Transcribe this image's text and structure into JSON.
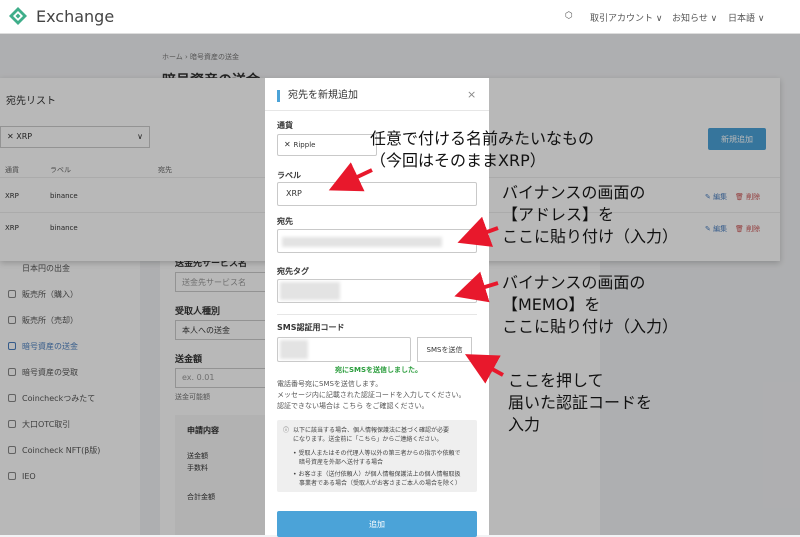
{
  "header": {
    "brand": "Exchange",
    "account_menu": "取引アカウント ∨",
    "notice_menu": "お知らせ ∨",
    "lang_menu": "日本語 ∨"
  },
  "page": {
    "breadcrumb": "ホーム  ›  暗号資産の送金",
    "title": "暗号資産の送金"
  },
  "sidebar": {
    "items": [
      {
        "label": "日本円の出金"
      },
      {
        "label": "販売所（購入）"
      },
      {
        "label": "販売所（売却）"
      },
      {
        "label": "暗号資産の送金"
      },
      {
        "label": "暗号資産の受取"
      },
      {
        "label": "Coincheckつみたて"
      },
      {
        "label": "大口OTC取引"
      },
      {
        "label": "Coincheck NFT(β版)"
      },
      {
        "label": "IEO"
      }
    ]
  },
  "main_form": {
    "service_label": "送金先サービス名",
    "service_placeholder": "送金先サービス名",
    "recipient_type_label": "受取人種別",
    "recipient_type_value": "本人への送金",
    "amount_label": "送金額",
    "amount_placeholder": "ex. 0.01",
    "available_label": "送金可能額",
    "summary_title": "申請内容",
    "summary_amount": "送金額",
    "summary_fee": "手数料",
    "summary_total": "合計金額"
  },
  "drawer": {
    "title": "宛先リスト",
    "currency_value": "XRP",
    "columns": [
      "通貨",
      "ラベル",
      "宛先"
    ],
    "rows": [
      {
        "currency": "XRP",
        "label": "binance"
      },
      {
        "currency": "XRP",
        "label": "binance"
      }
    ],
    "new_button": "新規追加",
    "edit": "✎ 編集",
    "delete": "🗑 削除"
  },
  "modal": {
    "title": "宛先を新規追加",
    "close": "×",
    "currency_label": "通貨",
    "currency_value": "Ripple",
    "label_label": "ラベル",
    "label_value": "XRP",
    "address_label": "宛先",
    "tag_label": "宛先タグ",
    "sms_label": "SMS認証用コード",
    "sms_button": "SMSを送信",
    "sms_sent": "宛にSMSを送信しました。",
    "note_1": "電話番号宛にSMSを送信します。",
    "note_2": "メッセージ内に記載された認証コードを入力してください。",
    "note_3": "認証できない場合は こちら をご確認ください。",
    "info_1": "以下に該当する場合、個人情報保護法に基づく確認が必要",
    "info_2": "になります。送金前に「こちら」からご連絡ください。",
    "info_3": "• 受取人またはその代理人等以外の第三者からの指示や依頼で",
    "info_4": "暗号資産を外部へ送付する場合",
    "info_5": "• お客さま（送付依頼人）が個人情報保護法上の個人情報取扱",
    "info_6": "事業者である場合（受取人がお客さまご本人の場合を除く）",
    "add_button": "追加"
  },
  "annotations": {
    "label_1": "任意で付ける名前みたいなもの",
    "label_2": "（今回はそのままXRP）",
    "addr_1": "バイナンスの画面の",
    "addr_2": "【アドレス】を",
    "addr_3": "ここに貼り付け（入力）",
    "memo_1": "バイナンスの画面の",
    "memo_2": "【MEMO】を",
    "memo_3": "ここに貼り付け（入力）",
    "sms_1": "ここを押して",
    "sms_2": "届いた認証コードを",
    "sms_3": "入力"
  },
  "colors": {
    "accent": "#4ba3d8",
    "success": "#2a9d3c",
    "arrow": "#e8182c"
  }
}
